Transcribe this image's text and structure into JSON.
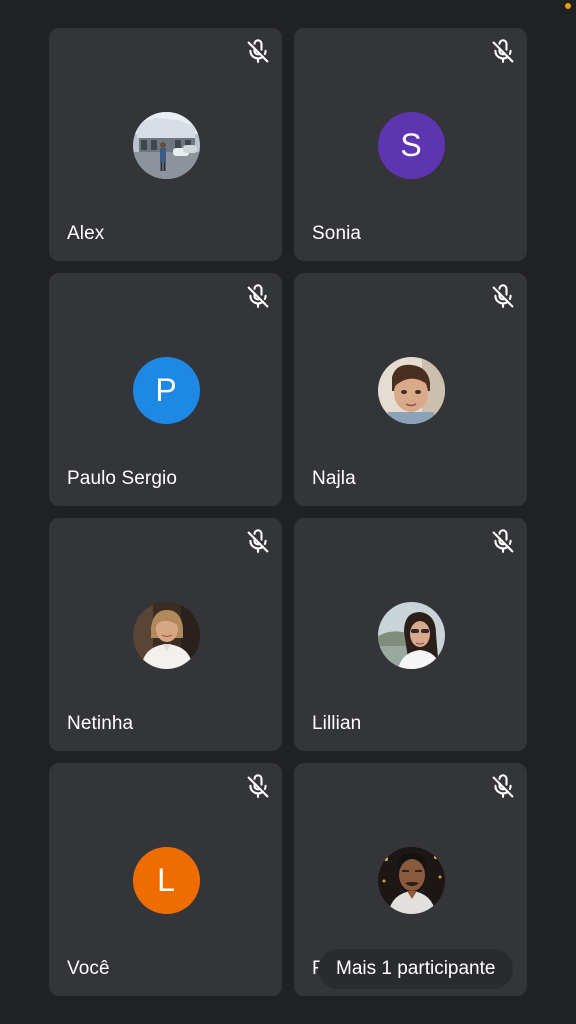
{
  "status": {
    "indicator_color": "#f29900",
    "indicator_icon": "recording-dot-icon"
  },
  "participants": [
    {
      "name": "Alex",
      "avatar": {
        "type": "photo",
        "icon": "photo-building-outdoor"
      },
      "muted": true
    },
    {
      "name": "Sonia",
      "avatar": {
        "type": "initial",
        "letter": "S",
        "color": "#5e35b1"
      },
      "muted": true
    },
    {
      "name": "Paulo Sergio",
      "avatar": {
        "type": "initial",
        "letter": "P",
        "color": "#1e88e5"
      },
      "muted": true
    },
    {
      "name": "Najla",
      "avatar": {
        "type": "photo",
        "icon": "photo-child-portrait"
      },
      "muted": true
    },
    {
      "name": "Netinha",
      "avatar": {
        "type": "photo",
        "icon": "photo-woman-portrait"
      },
      "muted": true
    },
    {
      "name": "Lillian",
      "avatar": {
        "type": "photo",
        "icon": "photo-woman-outdoor"
      },
      "muted": true
    },
    {
      "name": "Você",
      "avatar": {
        "type": "initial",
        "letter": "L",
        "color": "#ef6c00"
      },
      "muted": true
    },
    {
      "name": "R",
      "avatar": {
        "type": "photo",
        "icon": "photo-man-portrait"
      },
      "muted": true
    }
  ],
  "more_participants_label": "Mais 1 participante"
}
